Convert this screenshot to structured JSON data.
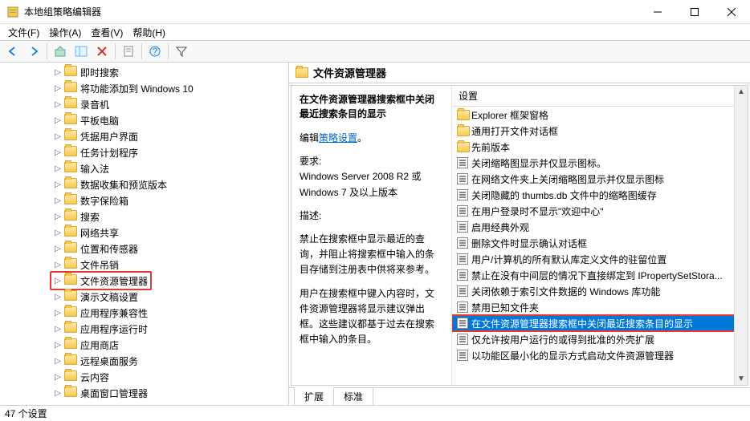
{
  "window": {
    "title": "本地组策略编辑器"
  },
  "menu": {
    "file": "文件(F)",
    "action": "操作(A)",
    "view": "查看(V)",
    "help": "帮助(H)"
  },
  "tree": {
    "items": [
      {
        "label": "即时搜索"
      },
      {
        "label": "将功能添加到 Windows 10"
      },
      {
        "label": "录音机"
      },
      {
        "label": "平板电脑"
      },
      {
        "label": "凭据用户界面"
      },
      {
        "label": "任务计划程序"
      },
      {
        "label": "输入法"
      },
      {
        "label": "数据收集和预览版本"
      },
      {
        "label": "数字保险箱"
      },
      {
        "label": "搜索"
      },
      {
        "label": "网络共享"
      },
      {
        "label": "位置和传感器"
      },
      {
        "label": "文件吊销"
      },
      {
        "label": "文件资源管理器",
        "highlighted": true
      },
      {
        "label": "演示文稿设置"
      },
      {
        "label": "应用程序兼容性"
      },
      {
        "label": "应用程序运行时"
      },
      {
        "label": "应用商店"
      },
      {
        "label": "远程桌面服务"
      },
      {
        "label": "云内容"
      },
      {
        "label": "桌面窗口管理器"
      }
    ]
  },
  "right": {
    "header": "文件资源管理器",
    "detail": {
      "title": "在文件资源管理器搜索框中关闭最近搜索条目的显示",
      "edit_prefix": "编辑",
      "edit_link": "策略设置",
      "req_label": "要求:",
      "req_text": "Windows Server 2008 R2 或 Windows 7 及以上版本",
      "desc_label": "描述:",
      "desc1": "禁止在搜索框中显示最近的查询，并阻止将搜索框中输入的条目存储到注册表中供将来参考。",
      "desc2": "用户在搜索框中键入内容时，文件资源管理器将显示建议弹出框。这些建议都基于过去在搜索框中输入的条目。"
    },
    "list": {
      "header": "设置",
      "items": [
        {
          "type": "folder",
          "label": "Explorer 框架窗格"
        },
        {
          "type": "folder",
          "label": "通用打开文件对话框"
        },
        {
          "type": "folder",
          "label": "先前版本"
        },
        {
          "type": "setting",
          "label": "关闭缩略图显示并仅显示图标。"
        },
        {
          "type": "setting",
          "label": "在网络文件夹上关闭缩略图显示并仅显示图标"
        },
        {
          "type": "setting",
          "label": "关闭隐藏的 thumbs.db 文件中的缩略图缓存"
        },
        {
          "type": "setting",
          "label": "在用户登录时不显示\"欢迎中心\""
        },
        {
          "type": "setting",
          "label": "启用经典外观"
        },
        {
          "type": "setting",
          "label": "删除文件时显示确认对话框"
        },
        {
          "type": "setting",
          "label": "用户/计算机的所有默认库定义文件的驻留位置"
        },
        {
          "type": "setting",
          "label": "禁止在没有中间层的情况下直接绑定到 IPropertySetStora..."
        },
        {
          "type": "setting",
          "label": "关闭依赖于索引文件数据的 Windows 库功能"
        },
        {
          "type": "setting",
          "label": "禁用已知文件夹"
        },
        {
          "type": "setting",
          "label": "在文件资源管理器搜索框中关闭最近搜索条目的显示",
          "selected": true
        },
        {
          "type": "setting",
          "label": "仅允许按用户运行的或得到批准的外壳扩展"
        },
        {
          "type": "setting",
          "label": "以功能区最小化的显示方式启动文件资源管理器"
        }
      ]
    }
  },
  "tabs": {
    "extended": "扩展",
    "standard": "标准"
  },
  "statusbar": {
    "text": "47 个设置"
  }
}
